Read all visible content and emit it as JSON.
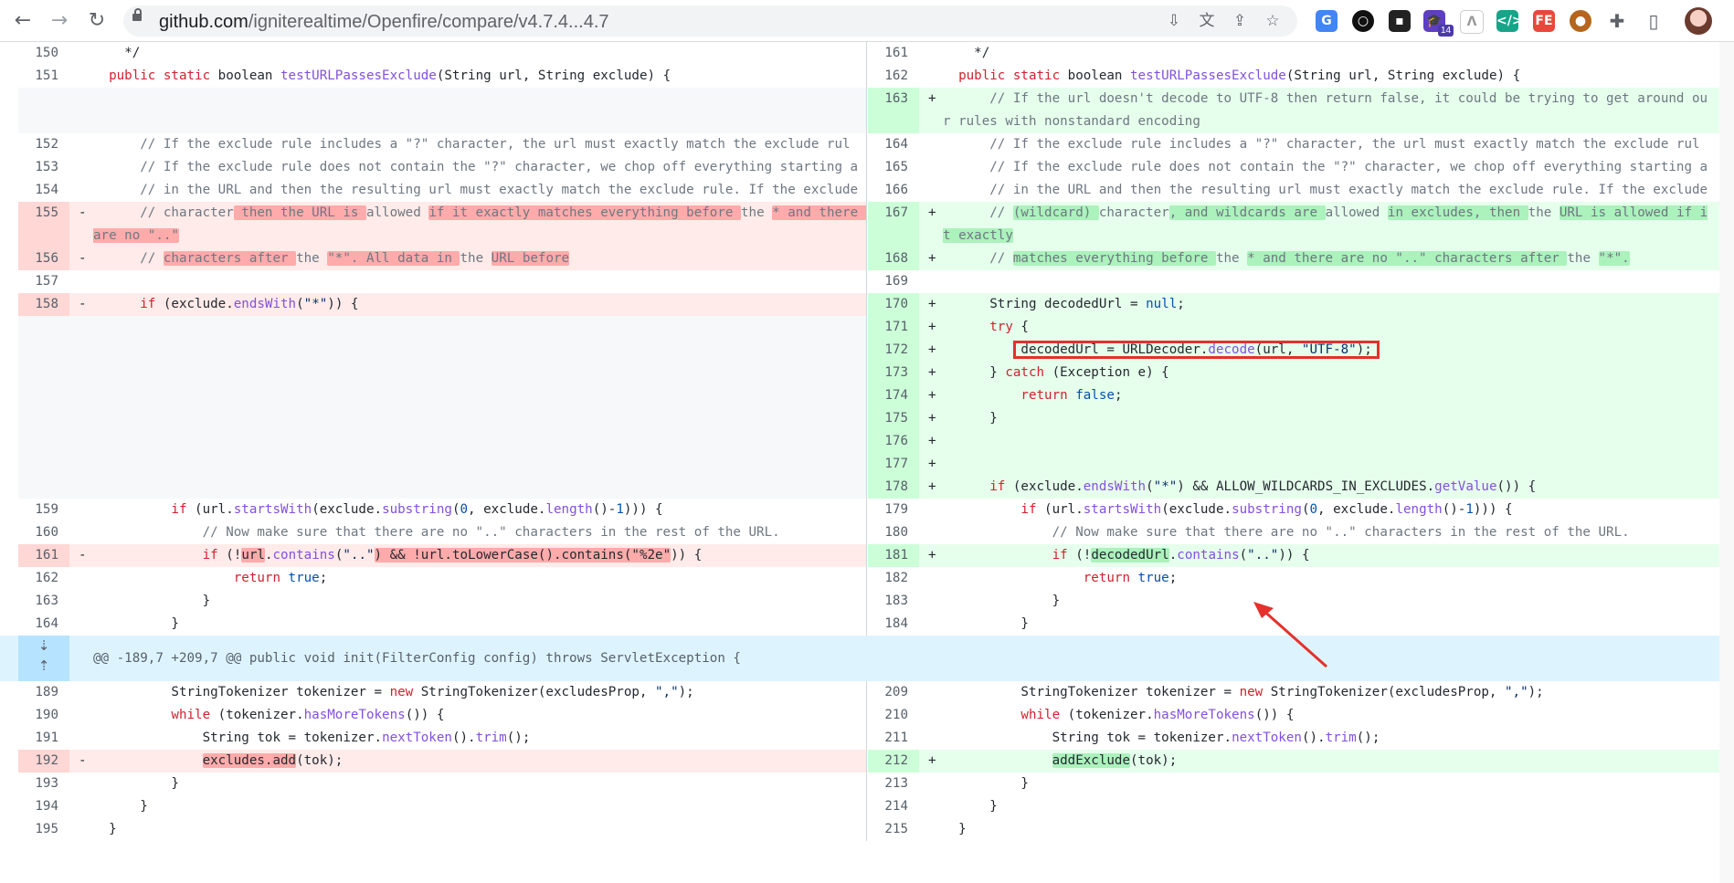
{
  "browser": {
    "url_domain": "github.com",
    "url_path": "/igniterealtime/Openfire/compare/v4.7.4...4.7",
    "extension_badge": "14"
  },
  "diff": {
    "hunk_header": "@@ -189,7 +209,7 @@ public void init(FilterConfig config) throws ServletException {",
    "rows": [
      {
        "h": 25,
        "l": {
          "n": "150",
          "t": "n",
          "c": "    */"
        },
        "r": {
          "n": "161",
          "t": "n",
          "c": "    */"
        }
      },
      {
        "h": 25,
        "l": {
          "n": "151",
          "t": "n",
          "c": "  <span class=\"k\">public</span> <span class=\"k\">static</span> boolean <span class=\"f\">testURLPassesExclude</span>(String url, String exclude) {"
        },
        "r": {
          "n": "162",
          "t": "n",
          "c": "  <span class=\"k\">public</span> <span class=\"k\">static</span> boolean <span class=\"f\">testURLPassesExclude</span>(String url, String exclude) {"
        }
      },
      {
        "h": 50,
        "l": {
          "t": "e"
        },
        "r": {
          "n": "163",
          "t": "a",
          "c": "      <span class=\"c\">// If the url doesn't decode to UTF-8 then return false, it could be trying to get around our rules with nonstandard encoding</span>"
        }
      },
      {
        "h": 25,
        "l": {
          "n": "152",
          "t": "n",
          "c": "      <span class=\"c\">// If the exclude rule includes a \"?\" character, the url must exactly match the exclude rule.</span>"
        },
        "r": {
          "n": "164",
          "t": "n",
          "c": "      <span class=\"c\">// If the exclude rule includes a \"?\" character, the url must exactly match the exclude rule.</span>"
        }
      },
      {
        "h": 25,
        "l": {
          "n": "153",
          "t": "n",
          "c": "      <span class=\"c\">// If the exclude rule does not contain the \"?\" character, we chop off everything starting at the first \"?\"</span>"
        },
        "r": {
          "n": "165",
          "t": "n",
          "c": "      <span class=\"c\">// If the exclude rule does not contain the \"?\" character, we chop off everything starting at the first \"?\"</span>"
        }
      },
      {
        "h": 25,
        "l": {
          "n": "154",
          "t": "n",
          "c": "      <span class=\"c\">// in the URL and then the resulting url must exactly match the exclude rule. If the exclude ends with a \"*\"</span>"
        },
        "r": {
          "n": "166",
          "t": "n",
          "c": "      <span class=\"c\">// in the URL and then the resulting url must exactly match the exclude rule. If the exclude ends with a \"*\"</span>"
        }
      },
      {
        "h": 50,
        "l": {
          "n": "155",
          "t": "d",
          "c": "      <span class=\"c\">// character<span class=\"hd\"> then the URL is </span>allowed <span class=\"hd\">if it exactly matches everything before </span>the <span class=\"hd\">* and there are no \"..\"</span></span>"
        },
        "r": {
          "n": "167",
          "t": "a",
          "c": "      <span class=\"c\">// <span class=\"ha\">(wildcard) </span>character<span class=\"ha\">, and wildcards are </span>allowed <span class=\"ha\">in excludes, then </span>the <span class=\"ha\">URL is allowed if it exactly</span></span>"
        }
      },
      {
        "h": 25,
        "l": {
          "n": "156",
          "t": "d",
          "c": "      <span class=\"c\">// <span class=\"hd\">characters after </span>the <span class=\"hd\">\"*\". All data in </span>the <span class=\"hd\">URL before</span></span>"
        },
        "r": {
          "n": "168",
          "t": "a",
          "c": "      <span class=\"c\">// <span class=\"ha\">matches everything before </span>the <span class=\"ha\">* and there are no \"..\" characters after </span>the <span class=\"ha\">\"*\".</span></span>"
        }
      },
      {
        "h": 25,
        "l": {
          "n": "157",
          "t": "n",
          "c": ""
        },
        "r": {
          "n": "169",
          "t": "n",
          "c": ""
        }
      },
      {
        "h": 25,
        "l": {
          "n": "158",
          "t": "d",
          "c": "      <span class=\"k\">if</span> (exclude.<span class=\"f\">endsWith</span>(<span class=\"s\">\"*\"</span>)) {"
        },
        "r": {
          "n": "170",
          "t": "a",
          "c": "      String decodedUrl = <span class=\"n\">null</span>;"
        }
      },
      {
        "h": 25,
        "l": {
          "t": "e"
        },
        "r": {
          "n": "171",
          "t": "a",
          "c": "      <span class=\"k\">try</span> {"
        }
      },
      {
        "h": 25,
        "l": {
          "t": "e"
        },
        "r": {
          "n": "172",
          "t": "a",
          "c": "          decodedUrl = URLDecoder.<span class=\"f\">decode</span>(url, <span class=\"s\">\"UTF-8\"</span>);"
        }
      },
      {
        "h": 25,
        "l": {
          "t": "e"
        },
        "r": {
          "n": "173",
          "t": "a",
          "c": "      } <span class=\"k\">catch</span> (Exception e) {"
        }
      },
      {
        "h": 25,
        "l": {
          "t": "e"
        },
        "r": {
          "n": "174",
          "t": "a",
          "c": "          <span class=\"k\">return</span> <span class=\"n\">false</span>;"
        }
      },
      {
        "h": 25,
        "l": {
          "t": "e"
        },
        "r": {
          "n": "175",
          "t": "a",
          "c": "      }"
        }
      },
      {
        "h": 25,
        "l": {
          "t": "e"
        },
        "r": {
          "n": "176",
          "t": "a",
          "c": ""
        }
      },
      {
        "h": 25,
        "l": {
          "t": "e"
        },
        "r": {
          "n": "177",
          "t": "a",
          "c": ""
        }
      },
      {
        "h": 25,
        "l": {
          "t": "e"
        },
        "r": {
          "n": "178",
          "t": "a",
          "c": "      <span class=\"k\">if</span> (exclude.<span class=\"f\">endsWith</span>(<span class=\"s\">\"*\"</span>) &amp;&amp; ALLOW_WILDCARDS_IN_EXCLUDES.<span class=\"f\">getValue</span>()) {"
        }
      },
      {
        "h": 25,
        "l": {
          "n": "159",
          "t": "n",
          "c": "          <span class=\"k\">if</span> (url.<span class=\"f\">startsWith</span>(exclude.<span class=\"f\">substring</span>(<span class=\"n\">0</span>, exclude.<span class=\"f\">length</span>()-<span class=\"n\">1</span>))) {"
        },
        "r": {
          "n": "179",
          "t": "n",
          "c": "          <span class=\"k\">if</span> (url.<span class=\"f\">startsWith</span>(exclude.<span class=\"f\">substring</span>(<span class=\"n\">0</span>, exclude.<span class=\"f\">length</span>()-<span class=\"n\">1</span>))) {"
        }
      },
      {
        "h": 25,
        "l": {
          "n": "160",
          "t": "n",
          "c": "              <span class=\"c\">// Now make sure that there are no \"..\" characters in the rest of the URL.</span>"
        },
        "r": {
          "n": "180",
          "t": "n",
          "c": "              <span class=\"c\">// Now make sure that there are no \"..\" characters in the rest of the URL.</span>"
        }
      },
      {
        "h": 25,
        "l": {
          "n": "161",
          "t": "d",
          "c": "              <span class=\"k\">if</span> (!<span class=\"hd\">url</span>.<span class=\"f\">contains</span>(<span class=\"s\">\"..\"</span><span class=\"hd\">) &amp;&amp; !url.toLowerCase().contains(\"%2e\"</span>)) {"
        },
        "r": {
          "n": "181",
          "t": "a",
          "c": "              <span class=\"k\">if</span> (!<span class=\"ha\">decodedUrl</span>.<span class=\"f\">contains</span>(<span class=\"s\">\"..\"</span>)) {"
        }
      },
      {
        "h": 25,
        "l": {
          "n": "162",
          "t": "n",
          "c": "                  <span class=\"k\">return</span> <span class=\"n\">true</span>;"
        },
        "r": {
          "n": "182",
          "t": "n",
          "c": "                  <span class=\"k\">return</span> <span class=\"n\">true</span>;"
        }
      },
      {
        "h": 25,
        "l": {
          "n": "163",
          "t": "n",
          "c": "              }"
        },
        "r": {
          "n": "183",
          "t": "n",
          "c": "              }"
        }
      },
      {
        "h": 25,
        "l": {
          "n": "164",
          "t": "n",
          "c": "          }"
        },
        "r": {
          "n": "184",
          "t": "n",
          "c": "          }"
        }
      },
      {
        "hunk": true,
        "h": 50
      },
      {
        "h": 25,
        "l": {
          "n": "189",
          "t": "n",
          "c": "          StringTokenizer tokenizer = <span class=\"k\">new</span> StringTokenizer(excludesProp, <span class=\"s\">\",\"</span>);"
        },
        "r": {
          "n": "209",
          "t": "n",
          "c": "          StringTokenizer tokenizer = <span class=\"k\">new</span> StringTokenizer(excludesProp, <span class=\"s\">\",\"</span>);"
        }
      },
      {
        "h": 25,
        "l": {
          "n": "190",
          "t": "n",
          "c": "          <span class=\"k\">while</span> (tokenizer.<span class=\"f\">hasMoreTokens</span>()) {"
        },
        "r": {
          "n": "210",
          "t": "n",
          "c": "          <span class=\"k\">while</span> (tokenizer.<span class=\"f\">hasMoreTokens</span>()) {"
        }
      },
      {
        "h": 25,
        "l": {
          "n": "191",
          "t": "n",
          "c": "              String tok = tokenizer.<span class=\"f\">nextToken</span>().<span class=\"f\">trim</span>();"
        },
        "r": {
          "n": "211",
          "t": "n",
          "c": "              String tok = tokenizer.<span class=\"f\">nextToken</span>().<span class=\"f\">trim</span>();"
        }
      },
      {
        "h": 25,
        "l": {
          "n": "192",
          "t": "d",
          "c": "              <span class=\"hd\">excludes.add</span>(tok);"
        },
        "r": {
          "n": "212",
          "t": "a",
          "c": "              <span class=\"ha\">addExclude</span>(tok);"
        }
      },
      {
        "h": 25,
        "l": {
          "n": "193",
          "t": "n",
          "c": "          }"
        },
        "r": {
          "n": "213",
          "t": "n",
          "c": "          }"
        }
      },
      {
        "h": 25,
        "l": {
          "n": "194",
          "t": "n",
          "c": "      }"
        },
        "r": {
          "n": "214",
          "t": "n",
          "c": "      }"
        }
      },
      {
        "h": 25,
        "l": {
          "n": "195",
          "t": "n",
          "c": "  }"
        },
        "r": {
          "n": "215",
          "t": "n",
          "c": "  }"
        }
      }
    ]
  }
}
